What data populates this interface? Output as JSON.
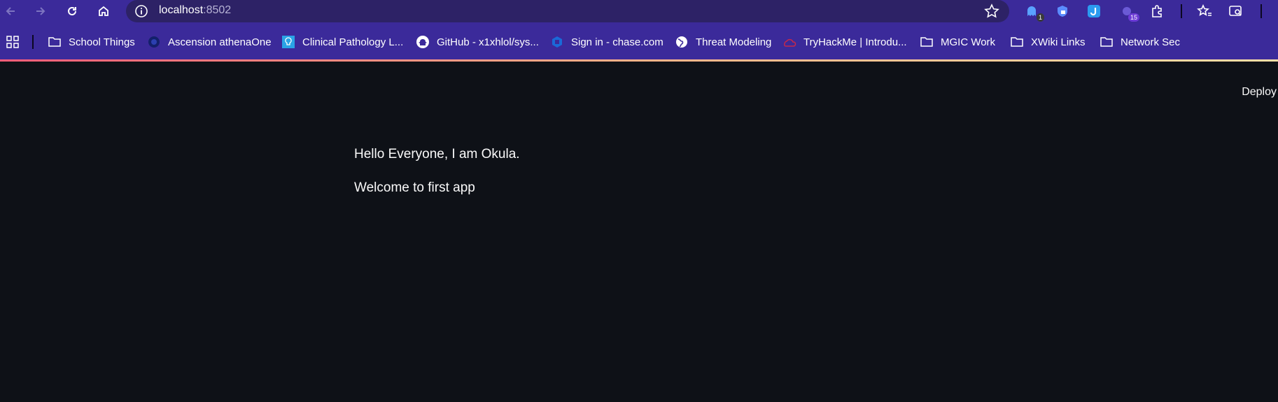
{
  "browser": {
    "url_host": "localhost",
    "url_port": ":8502"
  },
  "extensions": {
    "ext1_badge": "1",
    "ext5_badge": "15"
  },
  "bookmarks": [
    {
      "label": "School Things",
      "icon": "folder-icon"
    },
    {
      "label": "Ascension athenaOne",
      "icon": "athena-icon"
    },
    {
      "label": "Clinical Pathology L...",
      "icon": "lightbulb-icon"
    },
    {
      "label": "GitHub - x1xhlol/sys...",
      "icon": "github-icon"
    },
    {
      "label": "Sign in - chase.com",
      "icon": "chase-icon"
    },
    {
      "label": "Threat Modeling",
      "icon": "globe-icon"
    },
    {
      "label": "TryHackMe | Introdu...",
      "icon": "tryhackme-icon"
    },
    {
      "label": "MGIC Work",
      "icon": "folder-icon"
    },
    {
      "label": "XWiki Links",
      "icon": "folder-icon"
    },
    {
      "label": "Network Sec",
      "icon": "folder-icon"
    }
  ],
  "app": {
    "deploy_label": "Deploy",
    "line1": "Hello Everyone, I am Okula.",
    "line2": "Welcome to first app"
  },
  "colors": {
    "chrome": "#3b2a9a",
    "omnibox": "#2d2266",
    "app_bg": "#0e1117",
    "app_text": "#fafafa"
  }
}
